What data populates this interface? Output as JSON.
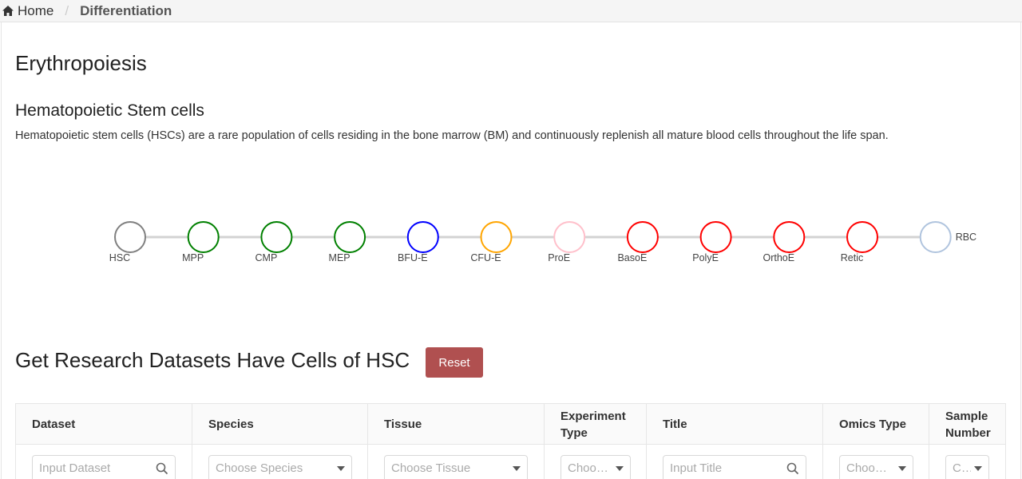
{
  "breadcrumb": {
    "home_label": "Home",
    "separator": "/",
    "current": "Differentiation"
  },
  "page": {
    "title": "Erythropoiesis",
    "section_title": "Hematopoietic Stem cells",
    "description": "Hematopoietic stem cells (HSCs) are a rare population of cells residing in the bone marrow (BM) and continuously replenish all mature blood cells throughout the life span."
  },
  "pathway": {
    "line_color": "#d3d3d3",
    "nodes": [
      {
        "label": "HSC",
        "color": "#808080"
      },
      {
        "label": "MPP",
        "color": "#008000"
      },
      {
        "label": "CMP",
        "color": "#008000"
      },
      {
        "label": "MEP",
        "color": "#008000"
      },
      {
        "label": "BFU-E",
        "color": "#0000ff"
      },
      {
        "label": "CFU-E",
        "color": "#ffa500"
      },
      {
        "label": "ProE",
        "color": "#ffc0cb"
      },
      {
        "label": "BasoE",
        "color": "#ff0000"
      },
      {
        "label": "PolyE",
        "color": "#ff0000"
      },
      {
        "label": "OrthoE",
        "color": "#ff0000"
      },
      {
        "label": "Retic",
        "color": "#ff0000"
      },
      {
        "label": "RBC",
        "color": "#b0c4de"
      }
    ]
  },
  "datasets": {
    "title": "Get Research Datasets Have Cells of HSC",
    "reset_label": "Reset",
    "reset_color": "#b05050",
    "columns": [
      {
        "header": "Dataset",
        "filter_placeholder": "Input Dataset",
        "filter_type": "search"
      },
      {
        "header": "Species",
        "filter_placeholder": "Choose Species",
        "filter_type": "select"
      },
      {
        "header": "Tissue",
        "filter_placeholder": "Choose Tissue",
        "filter_type": "select"
      },
      {
        "header": "Experiment Type",
        "filter_placeholder": "Choo…",
        "filter_type": "select"
      },
      {
        "header": "Title",
        "filter_placeholder": "Input Title",
        "filter_type": "search"
      },
      {
        "header": "Omics Type",
        "filter_placeholder": "Choo…",
        "filter_type": "select"
      },
      {
        "header": "Sample Number",
        "filter_placeholder": "C…",
        "filter_type": "select"
      }
    ]
  }
}
